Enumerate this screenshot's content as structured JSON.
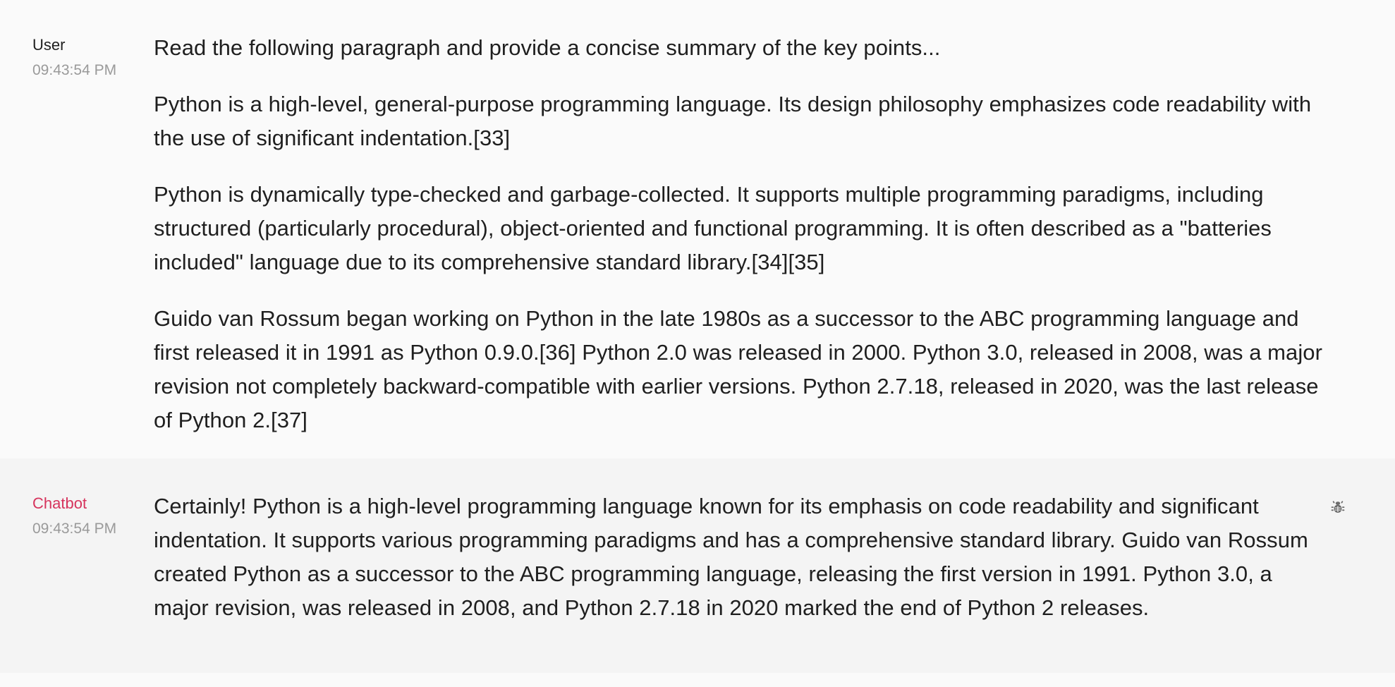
{
  "messages": {
    "user": {
      "author": "User",
      "timestamp": "09:43:54 PM",
      "paragraphs": [
        "Read the following paragraph and provide a concise summary of the key points...",
        "Python is a high-level, general-purpose programming language. Its design philosophy emphasizes code readability with the use of significant indentation.[33]",
        "Python is dynamically type-checked and garbage-collected. It supports multiple programming paradigms, including structured (particularly procedural), object-oriented and functional programming. It is often described as a \"batteries included\" language due to its comprehensive standard library.[34][35]",
        "Guido van Rossum began working on Python in the late 1980s as a successor to the ABC programming language and first released it in 1991 as Python 0.9.0.[36] Python 2.0 was released in 2000. Python 3.0, released in 2008, was a major revision not completely backward-compatible with earlier versions. Python 2.7.18, released in 2020, was the last release of Python 2.[37]"
      ]
    },
    "bot": {
      "author": "Chatbot",
      "timestamp": "09:43:54 PM",
      "text": "Certainly! Python is a high-level programming language known for its emphasis on code readability and significant indentation. It supports various programming paradigms and has a comprehensive standard library. Guido van Rossum created Python as a successor to the ABC programming language, releasing the first version in 1991. Python 3.0, a major revision, was released in 2008, and Python 2.7.18 in 2020 marked the end of Python 2 releases.",
      "action_icon": "bug-icon"
    }
  },
  "colors": {
    "bot_author": "#d6345d",
    "timestamp": "#9a9a9a",
    "user_bg": "#fafafa",
    "bot_bg": "#f4f4f4",
    "icon": "#6b6b6b"
  }
}
